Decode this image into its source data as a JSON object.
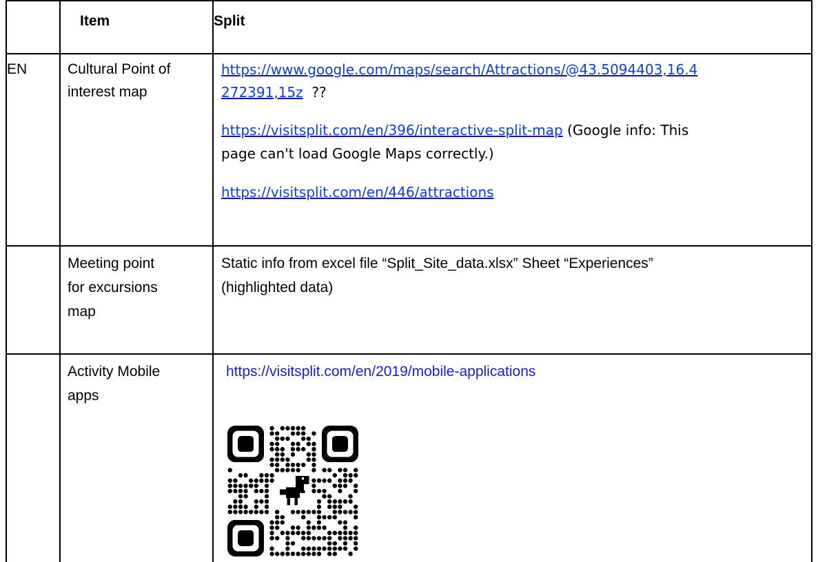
{
  "header": {
    "col_lang": "",
    "col_item": "Item",
    "col_split": "Split"
  },
  "rows": [
    {
      "lang": "EN",
      "item_line1": "Cultural Point of",
      "item_line2": "interest map",
      "link1_part1": "https://www.google.com/maps/search/Attractions/@43.5094403,16.4",
      "link1_part2": "272391,15z",
      "link1_suffix": "??",
      "link2": "https://visitsplit.com/en/396/interactive-split-map",
      "link2_note_part1": " (Google info: This",
      "link2_note_part2": "page can't load Google Maps correctly.)",
      "link3": "https://visitsplit.com/en/446/attractions"
    },
    {
      "lang": "",
      "item_line1": "Meeting point",
      "item_line2": "for excursions",
      "item_line3": "map",
      "text_line1": "Static info from excel file “Split_Site_data.xlsx” Sheet “Experiences”",
      "text_line2": "(highlighted data)"
    },
    {
      "lang": "",
      "item_line1": "Activity Mobile",
      "item_line2": "apps",
      "link": "https://visitsplit.com/en/2019/mobile-applications",
      "qr_icon": "qr-code-with-dinosaur"
    }
  ]
}
